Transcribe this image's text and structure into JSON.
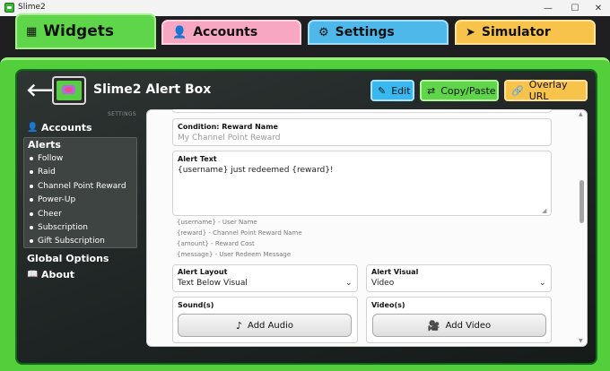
{
  "window": {
    "title": "Slime2",
    "controls": {
      "minimize": "—",
      "maximize": "☐",
      "close": "✕"
    }
  },
  "tabs": [
    {
      "label": "Widgets",
      "icon": "grid-icon",
      "glyph": "▦",
      "color": "#5fd64a",
      "active": true
    },
    {
      "label": "Accounts",
      "icon": "user-icon",
      "glyph": "👤",
      "color": "#f7a7c2"
    },
    {
      "label": "Settings",
      "icon": "gear-icon",
      "glyph": "⚙",
      "color": "#4fb8ea"
    },
    {
      "label": "Simulator",
      "icon": "send-icon",
      "glyph": "➤",
      "color": "#f7c34a"
    }
  ],
  "header": {
    "back_glyph": "🡐",
    "widget_name": "Slime2 Alert Box",
    "buttons": {
      "edit": {
        "label": "Edit",
        "glyph": "✎"
      },
      "copy": {
        "label": "Copy/Paste",
        "glyph": "⇄"
      },
      "overlay": {
        "label": "Overlay URL",
        "glyph": "🔗"
      }
    },
    "settings_caption": "SETTINGS"
  },
  "sidebar": {
    "accounts": {
      "label": "Accounts",
      "glyph": "👤"
    },
    "alerts": {
      "title": "Alerts",
      "items": [
        "Follow",
        "Raid",
        "Channel Point Reward",
        "Power-Up",
        "Cheer",
        "Subscription",
        "Gift Subscription"
      ]
    },
    "global_options": "Global Options",
    "about": {
      "label": "About",
      "glyph": "📖"
    }
  },
  "form": {
    "reward_name": {
      "label": "Condition: Reward Name",
      "placeholder": "My Channel Point Reward"
    },
    "alert_text": {
      "label": "Alert Text",
      "value": "{username} just redeemed {reward}!"
    },
    "hints": [
      "{username} - User Name",
      "{reward} - Channel Point Reward Name",
      "{amount} - Reward Cost",
      "{message} - User Redeem Message"
    ],
    "alert_layout": {
      "label": "Alert Layout",
      "value": "Text Below Visual"
    },
    "alert_visual": {
      "label": "Alert Visual",
      "value": "Video"
    },
    "sounds": {
      "label": "Sound(s)",
      "button": "Add Audio",
      "glyph": "♪"
    },
    "videos": {
      "label": "Video(s)",
      "button": "Add Video",
      "glyph": "🎥"
    }
  }
}
